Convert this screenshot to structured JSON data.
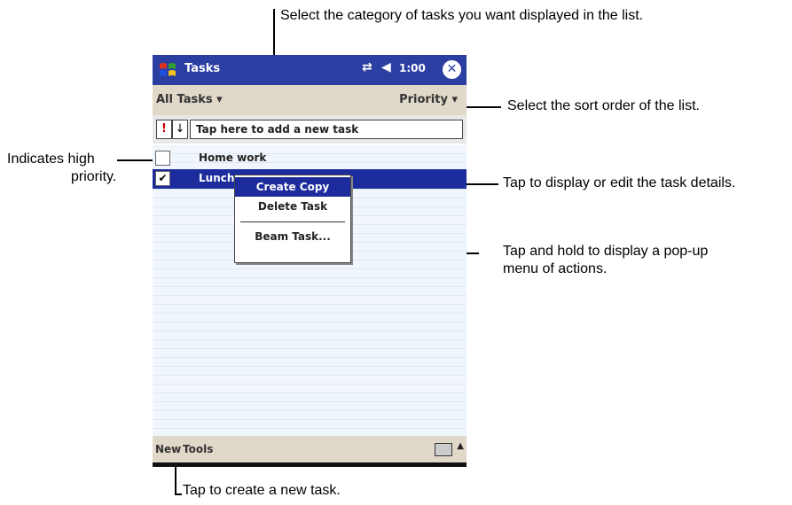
{
  "callouts": {
    "category": "Select the category of tasks you want displayed in the list.",
    "sort": "Select the sort order of the list.",
    "priority_line1": "Indicates high",
    "priority_line2": "priority.",
    "edit": "Tap to display or edit the task details.",
    "hold_line1": "Tap and hold to display a pop-up",
    "hold_line2": "menu of actions.",
    "new": "Tap to create a new task."
  },
  "titlebar": {
    "title": "Tasks",
    "connectivity_icon": "connectivity-icon",
    "volume_icon": "speaker-icon",
    "time": "1:00",
    "close_icon": "close-icon"
  },
  "filterbar": {
    "category": "All Tasks ▾",
    "sort": "Priority ▾"
  },
  "entrybar": {
    "priority_button": "!",
    "down_button": "↓",
    "add_task_placeholder": "Tap here to add a new task"
  },
  "tasks": [
    {
      "label": "Home work",
      "checked": false
    },
    {
      "label": "Lunch",
      "checked": true
    }
  ],
  "popup_menu": {
    "items": [
      "Create Copy",
      "Delete Task",
      "Beam Task..."
    ]
  },
  "bottombar": {
    "new": "New",
    "tools": "Tools"
  },
  "colors": {
    "titlebar": "#2b3fa2",
    "selection": "#1c2c9c",
    "bars": "#e0d8c8",
    "priority": "#d00000"
  }
}
